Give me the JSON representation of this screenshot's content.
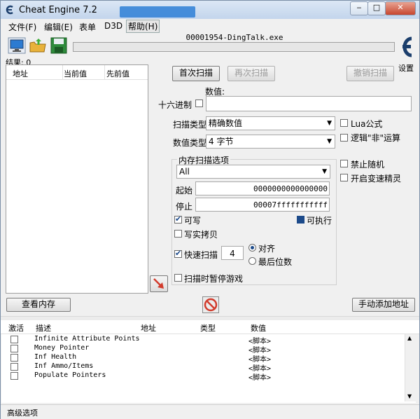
{
  "window": {
    "title": "Cheat Engine 7.2",
    "minimize": "‒",
    "maximize": "□",
    "close": "✕"
  },
  "menu": [
    "文件(F)",
    "编辑(E)",
    "表单",
    "D3D",
    "帮助(H)"
  ],
  "toolbar": {
    "icons": [
      "computer-icon",
      "open-folder-icon",
      "save-disk-icon"
    ]
  },
  "process": {
    "name": "00001954-DingTalk.exe"
  },
  "results": {
    "label": "结果: 0"
  },
  "settings_label": "设置",
  "found_list": {
    "columns": [
      "地址",
      "当前值",
      "先前值"
    ]
  },
  "scan": {
    "first_scan": "首次扫描",
    "next_scan": "再次扫描",
    "undo_scan": "撤销扫描",
    "value_label": "数值:",
    "hex_label": "十六进制",
    "value": "",
    "scan_type_label": "扫描类型",
    "scan_type": "精确数值",
    "value_type_label": "数值类型",
    "value_type": "4 字节",
    "lua_formula": "Lua公式",
    "not_logic": "逻辑\"非\"运算",
    "mem_options_label": "内存扫描选项",
    "mem_region": "All",
    "start_label": "起始",
    "start": "0000000000000000",
    "stop_label": "停止",
    "stop": "00007fffffffffff",
    "writable": "可写",
    "executable": "可执行",
    "copy_on_write": "写实拷贝",
    "fast_scan": "快速扫描",
    "fast_scan_value": "4",
    "align": "对齐",
    "last_digits": "最后位数",
    "pause_game": "扫描时暂停游戏",
    "disable_random": "禁止随机",
    "speedhack": "开启变速精灵"
  },
  "buttons": {
    "view_memory": "查看内存",
    "add_address": "手动添加地址"
  },
  "cheat_table": {
    "columns": [
      "激活",
      "描述",
      "地址",
      "类型",
      "数值"
    ],
    "rows": [
      {
        "desc": "Infinite Attribute Points",
        "value": "<脚本>"
      },
      {
        "desc": "Money Pointer",
        "value": "<脚本>"
      },
      {
        "desc": "Inf Health",
        "value": "<脚本>"
      },
      {
        "desc": "Inf Ammo/Items",
        "value": "<脚本>"
      },
      {
        "desc": "Populate Pointers",
        "value": "<脚本>"
      }
    ]
  },
  "status": {
    "advanced": "高级选项"
  },
  "colors": {
    "accent": "#1c4a8a",
    "title_bg": "#c3d5ec",
    "arrow_red": "#d23b2c"
  }
}
